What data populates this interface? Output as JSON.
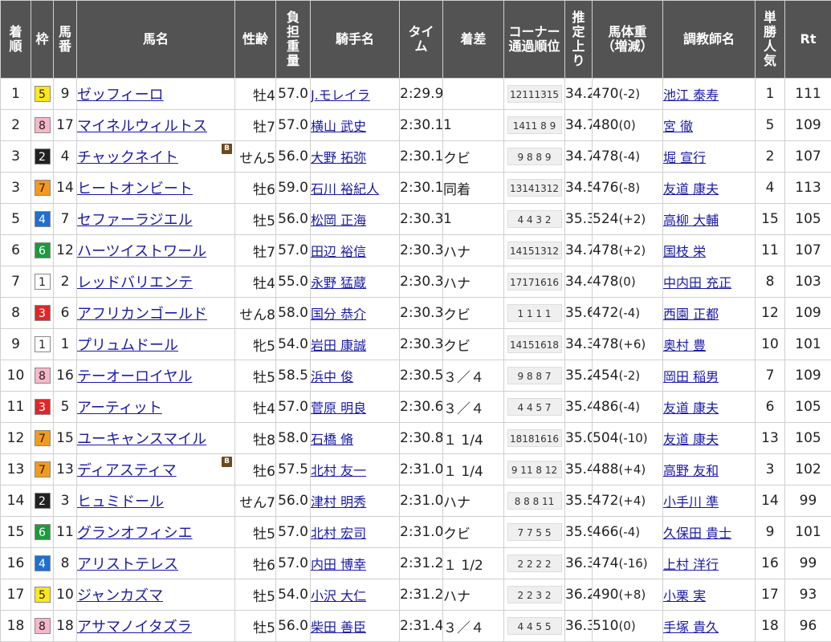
{
  "headers": {
    "rank": "着\n順",
    "waku": "枠",
    "num": "馬\n番",
    "horse": "馬名",
    "sexage": "性齢",
    "weight": "負\n担\n重\n量",
    "jockey": "騎手名",
    "time": "タイ\nム",
    "margin": "着差",
    "corner": "コーナー\n通過順位",
    "last3f": "推\n定\n上\nり",
    "bodyweight": "馬体重\n（増減）",
    "trainer": "調教師名",
    "pop": "単\n勝\n人\n気",
    "rt": "Rt"
  },
  "colors": {
    "header_bg": "#535353",
    "header_text": "#ffffff",
    "link": "#1a1aa6",
    "blinker": "#6b4a1f",
    "waku": {
      "1": {
        "bg": "#ffffff",
        "fg": "#222222"
      },
      "2": {
        "bg": "#222222",
        "fg": "#ffffff"
      },
      "3": {
        "bg": "#e0262a",
        "fg": "#ffffff"
      },
      "4": {
        "bg": "#1e6fd0",
        "fg": "#ffffff"
      },
      "5": {
        "bg": "#ffe71a",
        "fg": "#222222"
      },
      "6": {
        "bg": "#1e9a3c",
        "fg": "#ffffff"
      },
      "7": {
        "bg": "#f39a1e",
        "fg": "#222222"
      },
      "8": {
        "bg": "#f7b7c8",
        "fg": "#222222"
      }
    }
  },
  "blinker_label": "B",
  "rows": [
    {
      "rank": "1",
      "waku": "5",
      "num": "9",
      "horse": "ゼッフィーロ",
      "blinker": false,
      "sexage": "牡4",
      "weight": "57.0",
      "jockey": "J.モレイラ",
      "time": "2:29.9",
      "margin": "",
      "corner": "12111315",
      "last3f": "34.2",
      "bodyweight": "470",
      "diff": "(-2)",
      "trainer": "池江 泰寿",
      "pop": "1",
      "rt": "111"
    },
    {
      "rank": "2",
      "waku": "8",
      "num": "17",
      "horse": "マイネルウィルトス",
      "blinker": false,
      "sexage": "牡7",
      "weight": "57.0",
      "jockey": "横山 武史",
      "time": "2:30.1",
      "margin": "1",
      "corner": "1411 8  9",
      "last3f": "34.7",
      "bodyweight": "480",
      "diff": "(0)",
      "trainer": "宮 徹",
      "pop": "5",
      "rt": "109"
    },
    {
      "rank": "3",
      "waku": "2",
      "num": "4",
      "horse": "チャックネイト",
      "blinker": true,
      "sexage": "せん5",
      "weight": "56.0",
      "jockey": "大野 拓弥",
      "time": "2:30.1",
      "margin": "クビ",
      "corner": "9  8  8  9",
      "last3f": "34.7",
      "bodyweight": "478",
      "diff": "(-4)",
      "trainer": "堀 宣行",
      "pop": "2",
      "rt": "107"
    },
    {
      "rank": "3",
      "waku": "7",
      "num": "14",
      "horse": "ヒートオンビート",
      "blinker": false,
      "sexage": "牡6",
      "weight": "59.0",
      "jockey": "石川 裕紀人",
      "time": "2:30.1",
      "margin": "同着",
      "corner": "13141312",
      "last3f": "34.5",
      "bodyweight": "476",
      "diff": "(-8)",
      "trainer": "友道 康夫",
      "pop": "4",
      "rt": "113"
    },
    {
      "rank": "5",
      "waku": "4",
      "num": "7",
      "horse": "セファーラジエル",
      "blinker": false,
      "sexage": "牡5",
      "weight": "56.0",
      "jockey": "松岡 正海",
      "time": "2:30.3",
      "margin": "1",
      "corner": "4  4  3  2",
      "last3f": "35.3",
      "bodyweight": "524",
      "diff": "(+2)",
      "trainer": "高柳 大輔",
      "pop": "15",
      "rt": "105"
    },
    {
      "rank": "6",
      "waku": "6",
      "num": "12",
      "horse": "ハーツイストワール",
      "blinker": false,
      "sexage": "牡7",
      "weight": "57.0",
      "jockey": "田辺 裕信",
      "time": "2:30.3",
      "margin": "ハナ",
      "corner": "14151312",
      "last3f": "34.7",
      "bodyweight": "478",
      "diff": "(+2)",
      "trainer": "国枝 栄",
      "pop": "11",
      "rt": "107"
    },
    {
      "rank": "7",
      "waku": "1",
      "num": "2",
      "horse": "レッドバリエンテ",
      "blinker": false,
      "sexage": "牡4",
      "weight": "55.0",
      "jockey": "永野 猛蔵",
      "time": "2:30.3",
      "margin": "ハナ",
      "corner": "17171616",
      "last3f": "34.4",
      "bodyweight": "478",
      "diff": "(0)",
      "trainer": "中内田 充正",
      "pop": "8",
      "rt": "103"
    },
    {
      "rank": "8",
      "waku": "3",
      "num": "6",
      "horse": "アフリカンゴールド",
      "blinker": false,
      "sexage": "せん8",
      "weight": "58.0",
      "jockey": "国分 恭介",
      "time": "2:30.3",
      "margin": "クビ",
      "corner": "1  1  1  1",
      "last3f": "35.6",
      "bodyweight": "472",
      "diff": "(-4)",
      "trainer": "西園 正都",
      "pop": "12",
      "rt": "109"
    },
    {
      "rank": "9",
      "waku": "1",
      "num": "1",
      "horse": "プリュムドール",
      "blinker": false,
      "sexage": "牝5",
      "weight": "54.0",
      "jockey": "岩田 康誠",
      "time": "2:30.3",
      "margin": "クビ",
      "corner": "14151618",
      "last3f": "34.3",
      "bodyweight": "478",
      "diff": "(+6)",
      "trainer": "奥村 豊",
      "pop": "10",
      "rt": "101"
    },
    {
      "rank": "10",
      "waku": "8",
      "num": "16",
      "horse": "テーオーロイヤル",
      "blinker": false,
      "sexage": "牡5",
      "weight": "58.5",
      "jockey": "浜中 俊",
      "time": "2:30.5",
      "margin": "３／４",
      "corner": "9  8  8  7",
      "last3f": "35.2",
      "bodyweight": "454",
      "diff": "(-2)",
      "trainer": "岡田 稲男",
      "pop": "7",
      "rt": "109"
    },
    {
      "rank": "11",
      "waku": "3",
      "num": "5",
      "horse": "アーティット",
      "blinker": false,
      "sexage": "牡4",
      "weight": "57.0",
      "jockey": "菅原 明良",
      "time": "2:30.6",
      "margin": "３／４",
      "corner": "4  4  5  7",
      "last3f": "35.4",
      "bodyweight": "486",
      "diff": "(-4)",
      "trainer": "友道 康夫",
      "pop": "6",
      "rt": "105"
    },
    {
      "rank": "12",
      "waku": "7",
      "num": "15",
      "horse": "ユーキャンスマイル",
      "blinker": false,
      "sexage": "牡8",
      "weight": "58.0",
      "jockey": "石橋 脩",
      "time": "2:30.8",
      "margin": "１ 1/4",
      "corner": "18181616",
      "last3f": "35.0",
      "bodyweight": "504",
      "diff": "(-10)",
      "trainer": "友道 康夫",
      "pop": "13",
      "rt": "105"
    },
    {
      "rank": "13",
      "waku": "7",
      "num": "13",
      "horse": "ディアスティマ",
      "blinker": true,
      "sexage": "牡6",
      "weight": "57.5",
      "jockey": "北村 友一",
      "time": "2:31.0",
      "margin": "１ 1/4",
      "corner": "9 11 8 12",
      "last3f": "35.4",
      "bodyweight": "488",
      "diff": "(+4)",
      "trainer": "高野 友和",
      "pop": "3",
      "rt": "102"
    },
    {
      "rank": "14",
      "waku": "2",
      "num": "3",
      "horse": "ヒュミドール",
      "blinker": false,
      "sexage": "せん7",
      "weight": "56.0",
      "jockey": "津村 明秀",
      "time": "2:31.0",
      "margin": "ハナ",
      "corner": "8  8  8 11",
      "last3f": "35.5",
      "bodyweight": "472",
      "diff": "(+4)",
      "trainer": "小手川 準",
      "pop": "14",
      "rt": "99"
    },
    {
      "rank": "15",
      "waku": "6",
      "num": "11",
      "horse": "グランオフィシエ",
      "blinker": false,
      "sexage": "牡5",
      "weight": "57.0",
      "jockey": "北村 宏司",
      "time": "2:31.0",
      "margin": "クビ",
      "corner": "7  7  5  5",
      "last3f": "35.9",
      "bodyweight": "466",
      "diff": "(-4)",
      "trainer": "久保田 貴士",
      "pop": "9",
      "rt": "101"
    },
    {
      "rank": "16",
      "waku": "4",
      "num": "8",
      "horse": "アリストテレス",
      "blinker": false,
      "sexage": "牡6",
      "weight": "57.0",
      "jockey": "内田 博幸",
      "time": "2:31.2",
      "margin": "１ 1/2",
      "corner": "2  2  2  2",
      "last3f": "36.3",
      "bodyweight": "474",
      "diff": "(-16)",
      "trainer": "上村 洋行",
      "pop": "16",
      "rt": "99"
    },
    {
      "rank": "17",
      "waku": "5",
      "num": "10",
      "horse": "ジャンカズマ",
      "blinker": false,
      "sexage": "牡5",
      "weight": "54.0",
      "jockey": "小沢 大仁",
      "time": "2:31.2",
      "margin": "ハナ",
      "corner": "2  2  3  2",
      "last3f": "36.2",
      "bodyweight": "490",
      "diff": "(+8)",
      "trainer": "小栗 実",
      "pop": "17",
      "rt": "93"
    },
    {
      "rank": "18",
      "waku": "8",
      "num": "18",
      "horse": "アサマノイタズラ",
      "blinker": false,
      "sexage": "牡5",
      "weight": "56.0",
      "jockey": "柴田 善臣",
      "time": "2:31.4",
      "margin": "３／４",
      "corner": "4  4  5  5",
      "last3f": "36.3",
      "bodyweight": "510",
      "diff": "(0)",
      "trainer": "手塚 貴久",
      "pop": "18",
      "rt": "96"
    }
  ]
}
